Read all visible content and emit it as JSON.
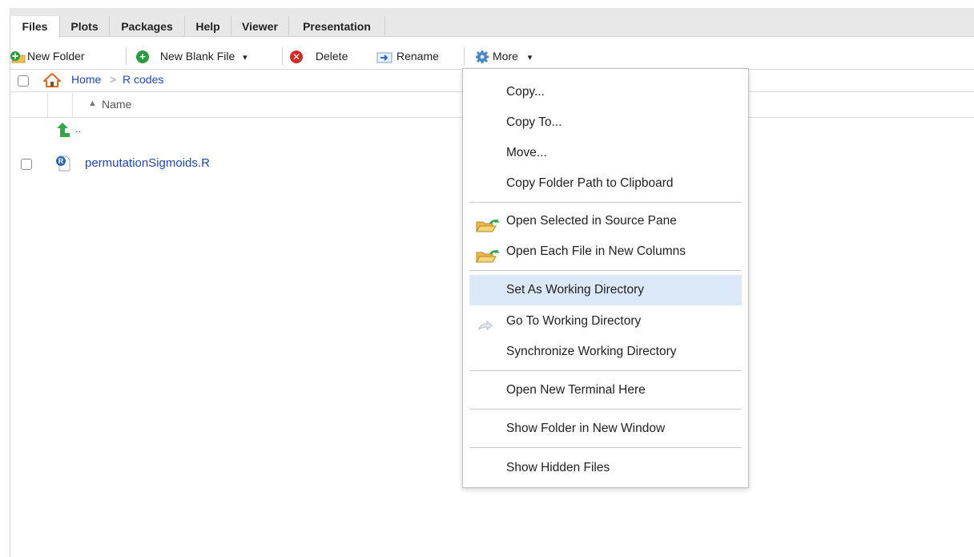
{
  "tabs": [
    {
      "label": "Files",
      "active": true
    },
    {
      "label": "Plots"
    },
    {
      "label": "Packages"
    },
    {
      "label": "Help"
    },
    {
      "label": "Viewer"
    },
    {
      "label": "Presentation"
    }
  ],
  "toolbar": {
    "new_folder": "New Folder",
    "new_blank_file": "New Blank File",
    "dropdown_arrow": "▾",
    "delete": "Delete",
    "rename": "Rename",
    "more": "More"
  },
  "breadcrumb": {
    "home": "Home",
    "separator": ">",
    "folder": "R codes"
  },
  "table": {
    "sort_indicator": "▲",
    "name_header": "Name",
    "parent_label": "..",
    "files": [
      {
        "name": "permutationSigmoids.R"
      }
    ]
  },
  "menu": {
    "items": [
      "Copy...",
      "Copy To...",
      "Move...",
      "Copy Folder Path to Clipboard",
      "Open Selected in Source Pane",
      "Open Each File in New Columns",
      "Set As Working Directory",
      "Go To Working Directory",
      "Synchronize Working Directory",
      "Open New Terminal Here",
      "Show Folder in New Window",
      "Show Hidden Files"
    ],
    "highlighted": "Set As Working Directory"
  },
  "colors": {
    "link": "#2046b8",
    "highlight": "#dbe8f7",
    "new_green": "#2e9a3e",
    "delete_red": "#d32a2a",
    "up_arrow_green": "#35a64b",
    "home_orange": "#e06a1b"
  },
  "icons": [
    "new-folder-icon",
    "add-circle-icon",
    "delete-circle-icon",
    "rename-icon",
    "gear-icon",
    "home-icon",
    "up-arrow-icon",
    "r-file-icon",
    "open-folder-icon",
    "go-arrow-icon",
    "sort-up-icon"
  ]
}
